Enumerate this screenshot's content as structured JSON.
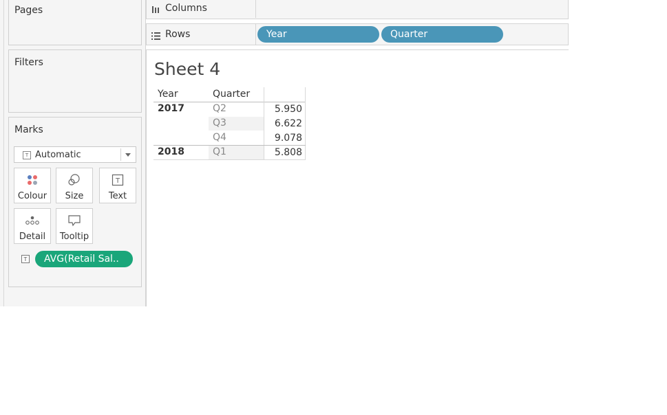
{
  "left_pane": {
    "pages_title": "Pages",
    "filters_title": "Filters",
    "marks": {
      "title": "Marks",
      "mark_type": "Automatic",
      "buttons": [
        {
          "label": "Colour",
          "icon": "colour-dots-icon"
        },
        {
          "label": "Size",
          "icon": "size-circles-icon"
        },
        {
          "label": "Text",
          "icon": "text-box-icon"
        },
        {
          "label": "Detail",
          "icon": "detail-dots-icon"
        },
        {
          "label": "Tooltip",
          "icon": "tooltip-bubble-icon"
        }
      ],
      "field_pill": "AVG(Retail Sal..",
      "field_pill_color": "#1aa67a"
    }
  },
  "shelves": {
    "columns_label": "Columns",
    "rows_label": "Rows",
    "rows_pills": [
      "Year",
      "Quarter"
    ],
    "pill_color": "#4a96b8"
  },
  "sheet": {
    "title": "Sheet 4",
    "table": {
      "headers": [
        "Year",
        "Quarter",
        ""
      ],
      "rows": [
        {
          "year": "2017",
          "quarter": "Q2",
          "value": "5.950"
        },
        {
          "year": "",
          "quarter": "Q3",
          "value": "6.622"
        },
        {
          "year": "",
          "quarter": "Q4",
          "value": "9.078"
        },
        {
          "year": "2018",
          "quarter": "Q1",
          "value": "5.808"
        }
      ]
    }
  }
}
